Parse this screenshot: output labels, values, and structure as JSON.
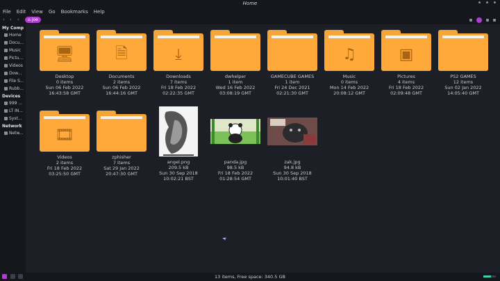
{
  "window": {
    "title": "Home"
  },
  "menu": [
    "File",
    "Edit",
    "View",
    "Go",
    "Bookmarks",
    "Help"
  ],
  "toolbar": {
    "crumb": "joe"
  },
  "sidebar": {
    "sections": [
      {
        "title": "My Comp",
        "items": [
          "Home",
          "Docu...",
          "Music",
          "Pictu...",
          "Videos",
          "Dow...",
          "File S...",
          "Rubb..."
        ]
      },
      {
        "title": "Devices",
        "items": [
          "999 ...",
          "LT IN...",
          "Syst..."
        ]
      },
      {
        "title": "Network",
        "items": [
          "Netw..."
        ]
      }
    ]
  },
  "files": [
    {
      "name": "Desktop",
      "meta": "0 items",
      "date": "Sun 06 Feb 2022",
      "time": "16:43:58 GMT",
      "icon": "desktop-icon",
      "glyph": "🖥"
    },
    {
      "name": "Documents",
      "meta": "2 items",
      "date": "Sun 06 Feb 2022",
      "time": "16:44:16 GMT",
      "icon": "document-icon",
      "glyph": "🗎"
    },
    {
      "name": "Downloads",
      "meta": "7 items",
      "date": "Fri 18 Feb 2022",
      "time": "02:22:35 GMT",
      "icon": "download-icon",
      "glyph": "⤓"
    },
    {
      "name": "dwhelper",
      "meta": "1 item",
      "date": "Wed 16 Feb 2022",
      "time": "03:08:19 GMT",
      "icon": "folder-icon",
      "glyph": ""
    },
    {
      "name": "GAMECUBE GAMES",
      "meta": "1 item",
      "date": "Fri 24 Dec 2021",
      "time": "02:21:30 GMT",
      "icon": "folder-icon",
      "glyph": ""
    },
    {
      "name": "Music",
      "meta": "0 items",
      "date": "Mon 14 Feb 2022",
      "time": "20:08:12 GMT",
      "icon": "music-icon",
      "glyph": "♫"
    },
    {
      "name": "Pictures",
      "meta": "4 items",
      "date": "Fri 18 Feb 2022",
      "time": "02:09:48 GMT",
      "icon": "picture-icon",
      "glyph": "▣"
    },
    {
      "name": "PS2 GAMES",
      "meta": "12 items",
      "date": "Sun 02 Jan 2022",
      "time": "14:05:40 GMT",
      "icon": "folder-icon",
      "glyph": ""
    },
    {
      "name": "Videos",
      "meta": "2 items",
      "date": "Fri 18 Feb 2022",
      "time": "03:25:50 GMT",
      "icon": "film-icon",
      "glyph": "🎞"
    },
    {
      "name": "zphisher",
      "meta": "7 items",
      "date": "Sat 29 Jan 2022",
      "time": "20:47:30 GMT",
      "icon": "folder-icon",
      "glyph": ""
    },
    {
      "name": "angel.png",
      "meta": "209.5 kB",
      "date": "Sun 30 Sep 2018",
      "time": "10:02:21 BST",
      "icon": "image-thumbnail",
      "glyph": ""
    },
    {
      "name": "panda.jpg",
      "meta": "98.5 kB",
      "date": "Fri 18 Feb 2022",
      "time": "01:28:54 GMT",
      "icon": "image-thumbnail",
      "glyph": ""
    },
    {
      "name": "zak.jpg",
      "meta": "94.8 kB",
      "date": "Sun 30 Sep 2018",
      "time": "10:01:40 BST",
      "icon": "image-thumbnail",
      "glyph": ""
    }
  ],
  "status": {
    "text": "13 items, Free space: 340.5 GB",
    "zoom_fraction": 0.6
  },
  "colors": {
    "folder": "#ffa93a",
    "accent": "#b13ed4",
    "zoom": "#3fd0b0"
  }
}
